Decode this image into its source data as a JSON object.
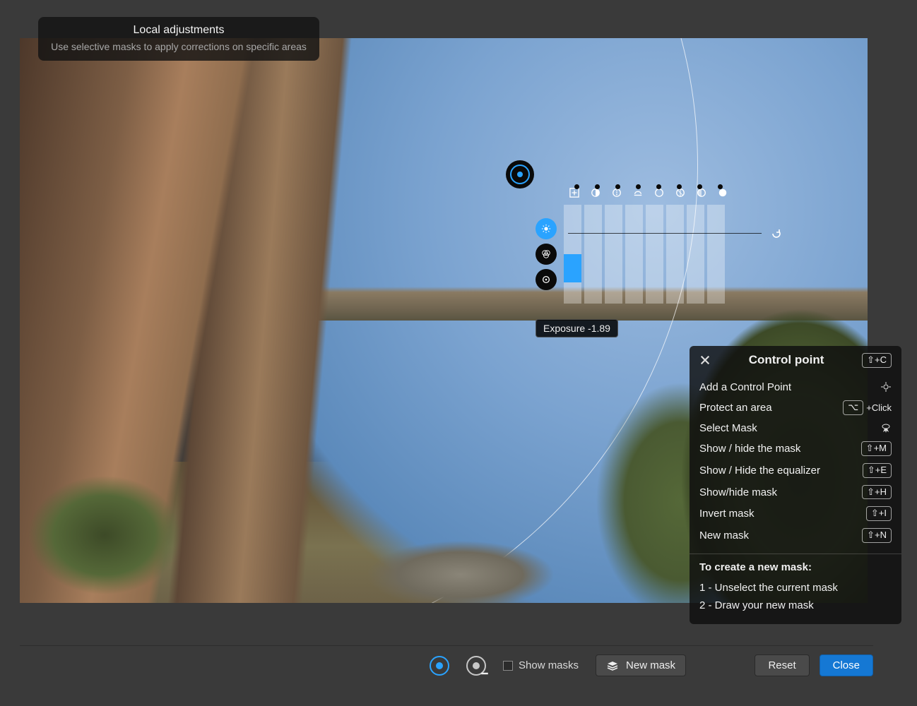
{
  "tooltip": {
    "title": "Local adjustments",
    "subtitle": "Use selective masks to apply corrections on specific areas"
  },
  "equalizer": {
    "icons": [
      "exposure",
      "contrast",
      "microcontrast",
      "clearview",
      "highlights",
      "midtones",
      "shadows",
      "blacks"
    ],
    "bars_pct": [
      28,
      0,
      0,
      0,
      0,
      0,
      0,
      0
    ],
    "readout_label": "Exposure",
    "readout_value": "-1.89"
  },
  "cp": {
    "title": "Control point",
    "title_shortcut": "⇧+C",
    "rows": [
      {
        "label": "Add a Control Point",
        "rt_kind": "target-icon"
      },
      {
        "label": "Protect an area",
        "rt_kind": "opt-click",
        "rt_text": "+Click"
      },
      {
        "label": "Select Mask",
        "rt_kind": "cursor-icon"
      },
      {
        "label": "Show / hide the mask",
        "rt_kind": "kbd",
        "rt_text": "⇧+M"
      },
      {
        "label": "Show / Hide the equalizer",
        "rt_kind": "kbd",
        "rt_text": "⇧+E"
      },
      {
        "label": "Show/hide mask",
        "rt_kind": "kbd",
        "rt_text": "⇧+H"
      },
      {
        "label": "Invert mask",
        "rt_kind": "kbd",
        "rt_text": "⇧+I"
      },
      {
        "label": "New mask",
        "rt_kind": "kbd",
        "rt_text": "⇧+N"
      }
    ],
    "instr_title": "To create a new mask:",
    "instr_steps": [
      "1 - Unselect the current mask",
      "2 - Draw your new mask"
    ]
  },
  "bottombar": {
    "show_masks_label": "Show masks",
    "new_mask_label": "New mask",
    "reset_label": "Reset",
    "close_label": "Close"
  }
}
